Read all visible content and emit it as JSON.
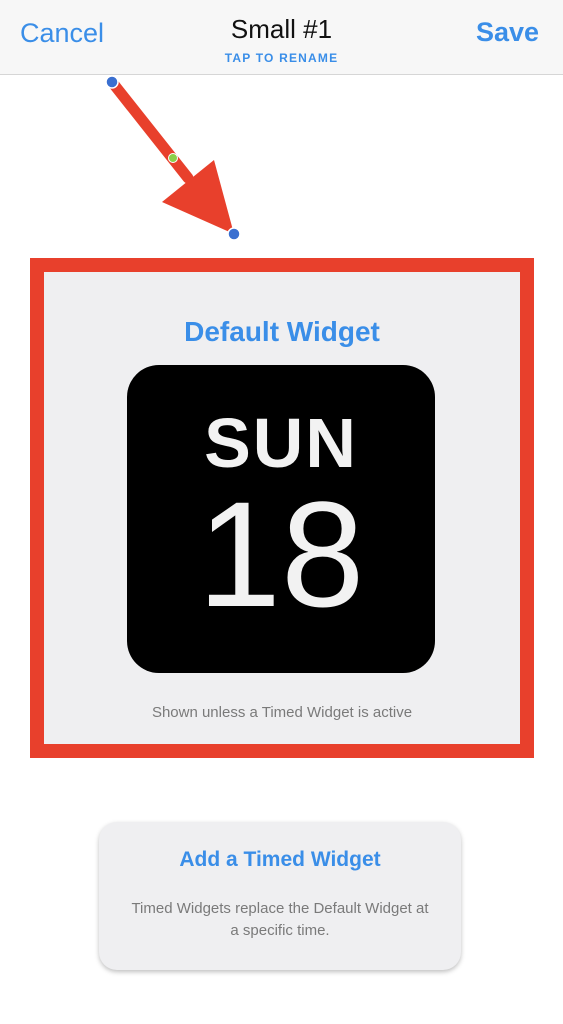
{
  "navbar": {
    "cancel_label": "Cancel",
    "title": "Small #1",
    "subtitle": "TAP TO RENAME",
    "save_label": "Save"
  },
  "default_widget": {
    "title": "Default Widget",
    "day": "SUN",
    "date": "18",
    "caption": "Shown unless a Timed Widget is active"
  },
  "timed_widget": {
    "button_label": "Add a Timed Widget",
    "description": "Timed Widgets replace the Default Widget at a specific time."
  },
  "colors": {
    "accent": "#3a8ee8",
    "annotation_red": "#e8402c",
    "widget_bg": "#000000",
    "panel_bg": "#efeff1"
  }
}
